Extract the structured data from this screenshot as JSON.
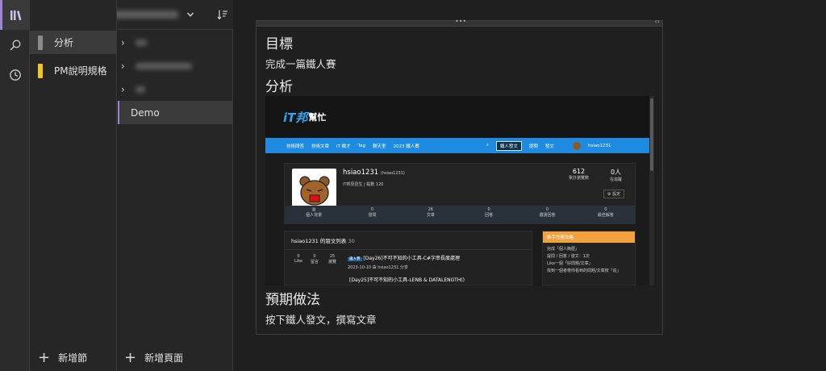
{
  "sidebar_rail": {
    "items": [
      {
        "icon": "notebooks-icon",
        "active": true
      },
      {
        "icon": "search-icon",
        "active": false
      },
      {
        "icon": "recent-clock-icon",
        "active": false
      }
    ]
  },
  "notebook_bar": {
    "notebook_name_blurred": true,
    "icons": [
      "notebook-sync-icon",
      "chevron-down-icon",
      "sort-icon"
    ]
  },
  "sections": {
    "items": [
      {
        "label": "分析",
        "color": "#8a8a8a",
        "active": true
      },
      {
        "label": "PM說明規格",
        "color": "#f5c518",
        "active": false
      }
    ],
    "add_label": "新增節"
  },
  "pages": {
    "items": [
      {
        "label": "",
        "blurred": true,
        "expandable": true
      },
      {
        "label": "",
        "blurred": true,
        "expandable": true
      },
      {
        "label": "",
        "blurred": true,
        "expandable": true
      },
      {
        "label": "Demo",
        "blurred": false,
        "expandable": false,
        "active": true
      }
    ],
    "add_label": "新增頁面"
  },
  "note": {
    "h_goal": "目標",
    "goal_text": "完成一篇鐵人賽",
    "h_analysis": "分析",
    "h_expected": "預期做法",
    "expected_text": "按下鐵人發文，撰寫文章",
    "embedded": {
      "logo_it": "iT邦",
      "logo_zh": "幫忙",
      "nav": [
        "技術問答",
        "技術文章",
        "iT 徵才",
        "Tag",
        "聊天室",
        "2023 鐵人賽"
      ],
      "nav_right": [
        "鐵人發文",
        "提問",
        "發文"
      ],
      "username": "hsiao1231",
      "user_handle": "(hsiao1231)",
      "rank_text": "iT邦見習生 | 點數 120",
      "views": "612",
      "views_label": "累計瀏覽數",
      "followers": "0人",
      "followers_label": "在追蹤",
      "settings_label": "設定",
      "stats": [
        {
          "value": "",
          "label": "個人背景"
        },
        {
          "value": "0",
          "label": "發問"
        },
        {
          "value": "26",
          "label": "文章"
        },
        {
          "value": "0",
          "label": "回答"
        },
        {
          "value": "0",
          "label": "邀請回答"
        },
        {
          "value": "0",
          "label": "最佳解答"
        }
      ],
      "list_title": "hsiao1231 的發文列表",
      "list_count": "30",
      "post1": {
        "like": "0",
        "reply": "0",
        "views": "25",
        "tag": "鐵人賽",
        "title": "[Day26]不可不知的小工具-C#字串長度處理",
        "date": "2023-10-10 由 hsiao1231 分享"
      },
      "post2_title": "[Day25]不可不知的小工具-LENB & DATALENGTH()",
      "side_title": "新手任務攻略",
      "side_lines": [
        "完成「個人簡歷」",
        "提問 / 回答 / 發文：1次",
        "Like一個「好問題/文章」",
        "找到一個者帶你看到的問題/文章按「追」"
      ]
    }
  }
}
